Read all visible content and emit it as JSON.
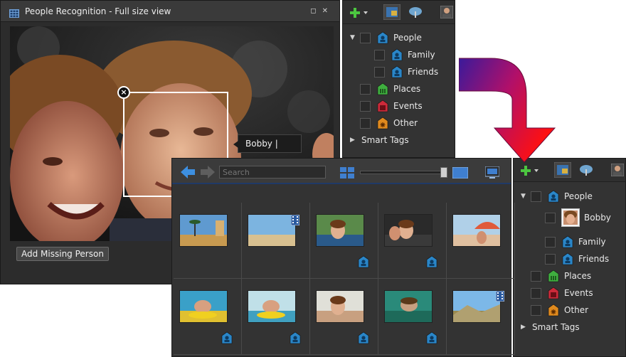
{
  "photo_window": {
    "title": "People Recognition - Full size view",
    "name_tag_value": "Bobby |",
    "add_missing_label": "Add Missing Person"
  },
  "browser": {
    "search_placeholder": "Search",
    "accent": "#203a68"
  },
  "tags_top": {
    "items": [
      {
        "label": "People",
        "icon": "people-tag-icon",
        "level": 0,
        "expanded": true
      },
      {
        "label": "Family",
        "icon": "person-tag-icon",
        "level": 1
      },
      {
        "label": "Friends",
        "icon": "person-tag-icon",
        "level": 1
      },
      {
        "label": "Places",
        "icon": "places-tag-icon",
        "level": 0
      },
      {
        "label": "Events",
        "icon": "events-tag-icon",
        "level": 0
      },
      {
        "label": "Other",
        "icon": "other-tag-icon",
        "level": 0
      }
    ],
    "smart_tags": "Smart Tags"
  },
  "tags_bottom": {
    "items": [
      {
        "label": "People",
        "icon": "people-tag-icon",
        "level": 0,
        "expanded": true
      },
      {
        "label": "Bobby",
        "icon": "person-photo-icon",
        "level": 1
      },
      {
        "label": "Family",
        "icon": "person-tag-icon",
        "level": 1
      },
      {
        "label": "Friends",
        "icon": "person-tag-icon",
        "level": 1
      },
      {
        "label": "Places",
        "icon": "places-tag-icon",
        "level": 0
      },
      {
        "label": "Events",
        "icon": "events-tag-icon",
        "level": 0
      },
      {
        "label": "Other",
        "icon": "other-tag-icon",
        "level": 0
      }
    ],
    "smart_tags": "Smart Tags"
  },
  "colors": {
    "people": "#2a86c8",
    "places": "#3fae3f",
    "events": "#cc2a3a",
    "other": "#e08a1e"
  }
}
